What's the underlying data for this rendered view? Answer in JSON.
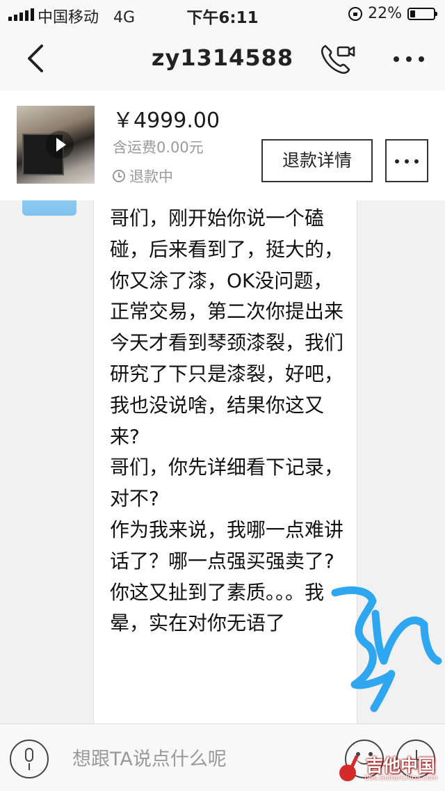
{
  "status_bar": {
    "carrier": "中国移动",
    "network": "4G",
    "time": "下午6:11",
    "battery_percent_label": "22%",
    "battery_level": 0.22
  },
  "nav": {
    "title": "zy1314588",
    "back_icon": "chevron-left-icon",
    "call_icon": "phone-video-icon",
    "more_icon": "ellipsis-icon"
  },
  "product": {
    "price": "￥4999.00",
    "shipping": "含运费0.00元",
    "status": "退款中",
    "refund_button": "退款详情",
    "more_button_icon": "ellipsis-icon"
  },
  "message": {
    "text": "哥们，刚开始你说一个磕碰，后来看到了，挺大的，你又涂了漆，OK没问题，正常交易，第二次你提出来今天才看到琴颈漆裂，我们研究了下只是漆裂，好吧，我也没说啥，结果你这又来?\n哥们，你先详细看下记录，对不?\n作为我来说，我哪一点难讲话了？哪一点强买强卖了?\n你这又扯到了素质。。。我晕，实在对你无语了"
  },
  "input_bar": {
    "placeholder": "想跟TA说点什么呢"
  },
  "watermark": {
    "main": "吉他中国",
    "sub": "bbs.GuitarChina.com"
  },
  "colors": {
    "annotation_scribble": "#2ea6f0",
    "background": "#f1f1f1"
  }
}
